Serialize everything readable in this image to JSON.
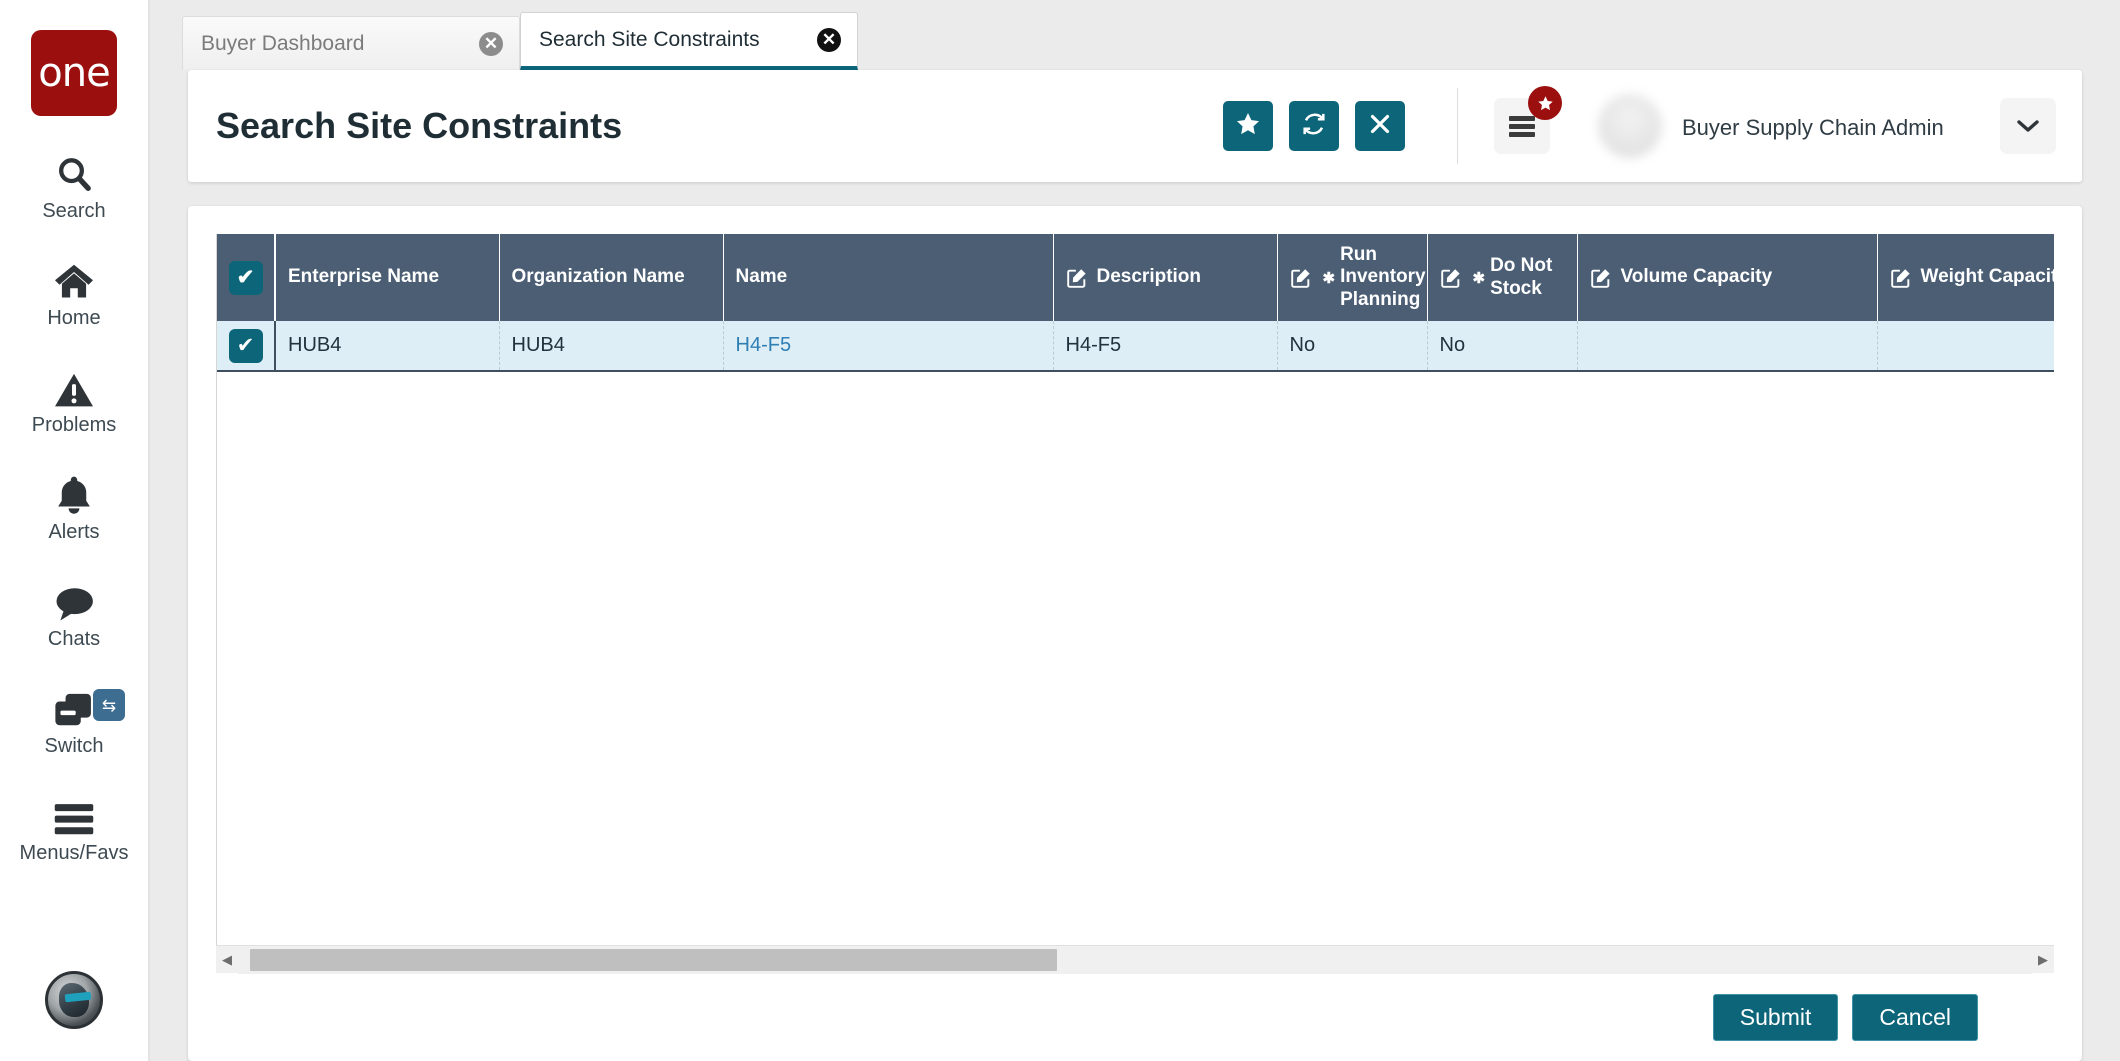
{
  "brand": {
    "logo_text": "one",
    "logo_color": "#9b0f0f"
  },
  "sidebar": {
    "items": [
      {
        "icon": "search-icon",
        "label": "Search"
      },
      {
        "icon": "home-icon",
        "label": "Home"
      },
      {
        "icon": "problems-icon",
        "label": "Problems"
      },
      {
        "icon": "alerts-icon",
        "label": "Alerts"
      },
      {
        "icon": "chats-icon",
        "label": "Chats"
      },
      {
        "icon": "switch-icon",
        "label": "Switch"
      },
      {
        "icon": "menus-favs-icon",
        "label": "Menus/Favs"
      }
    ],
    "avatar_name": "user-avatar"
  },
  "tabs": [
    {
      "label": "Buyer Dashboard",
      "active": false,
      "close_icon": "close-icon"
    },
    {
      "label": "Search Site Constraints",
      "active": true,
      "close_icon": "close-icon"
    }
  ],
  "header": {
    "title": "Search Site Constraints",
    "actions": [
      {
        "name": "favorite-button",
        "icon": "star-icon"
      },
      {
        "name": "refresh-button",
        "icon": "refresh-icon"
      },
      {
        "name": "close-button",
        "icon": "close-icon"
      }
    ],
    "menu_favs": {
      "icon": "hamburger-icon",
      "badge_icon": "star-icon"
    },
    "user": {
      "name": "",
      "role": "Buyer Supply Chain Admin",
      "org": "",
      "caret": "chevron-down-icon"
    },
    "accent_color": "#0c6579"
  },
  "grid": {
    "select_all_checked": true,
    "columns": [
      {
        "label": "",
        "key": "check",
        "editable": false,
        "required": false
      },
      {
        "label": "Enterprise Name",
        "key": "ent",
        "editable": false,
        "required": false
      },
      {
        "label": "Organization Name",
        "key": "org",
        "editable": false,
        "required": false
      },
      {
        "label": "Name",
        "key": "name",
        "editable": false,
        "required": false
      },
      {
        "label": "Description",
        "key": "desc",
        "editable": true,
        "required": false
      },
      {
        "label": "Run Inventory Planning",
        "key": "rip",
        "editable": true,
        "required": true
      },
      {
        "label": "Do Not Stock",
        "key": "dns",
        "editable": true,
        "required": true
      },
      {
        "label": "Volume Capacity",
        "key": "vol",
        "editable": true,
        "required": false
      },
      {
        "label": "Weight Capacity",
        "key": "wgt",
        "editable": true,
        "required": false
      }
    ],
    "rows": [
      {
        "selected": true,
        "ent": "HUB4",
        "org": "HUB4",
        "name": "H4-F5",
        "desc": "H4-F5",
        "rip": "No",
        "dns": "No",
        "vol": "",
        "wgt": ""
      }
    ],
    "header_bg": "#4b5e74",
    "row_selected_bg": "#ddeef7",
    "link_color": "#2f7fb5"
  },
  "scrollbar": {
    "left_arrow": "chevron-left-icon",
    "right_arrow": "chevron-right-icon",
    "thumb_percent": "45"
  },
  "footer": {
    "submit_label": "Submit",
    "cancel_label": "Cancel"
  }
}
